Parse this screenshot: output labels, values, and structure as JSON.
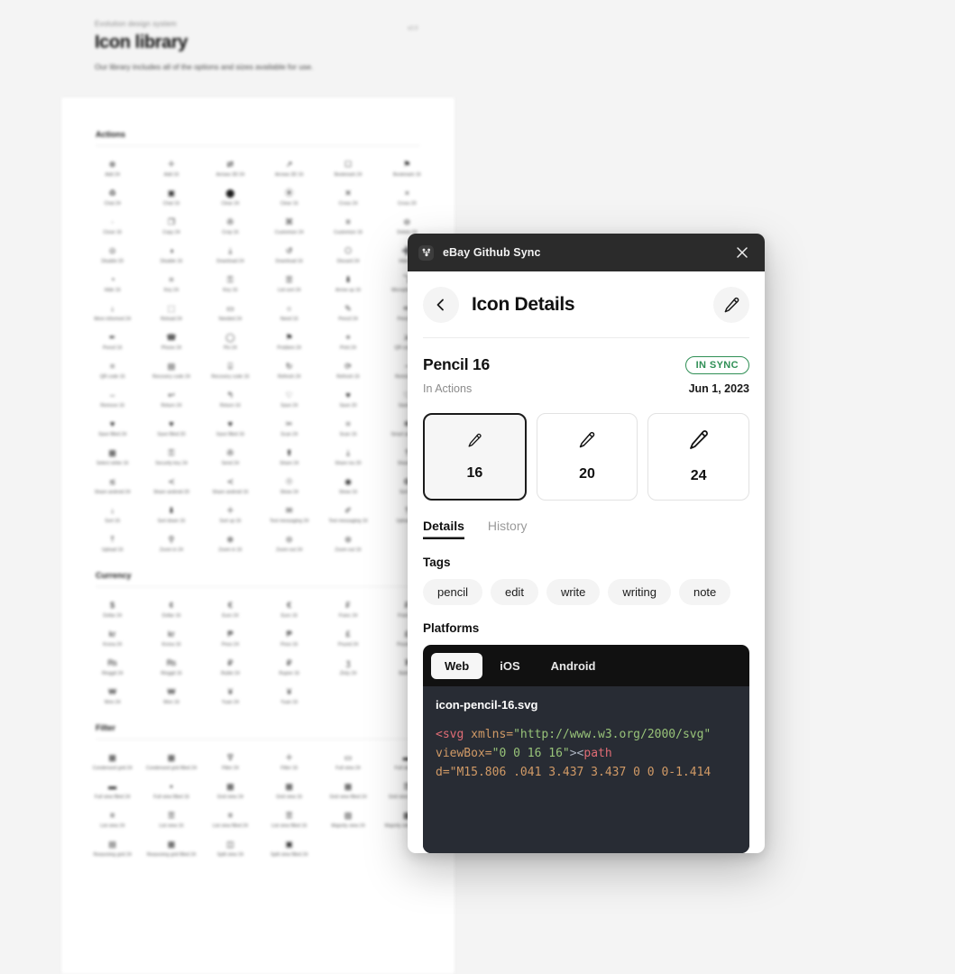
{
  "background": {
    "eyebrow": "Evolution design system",
    "title": "Icon library",
    "subtitle": "Our library includes all of the options and sizes available for use.",
    "corner_note": "v2.0",
    "sections": [
      {
        "name": "Actions",
        "icons": [
          {
            "glyph": "⊕",
            "label": "Add 24"
          },
          {
            "glyph": "＋",
            "label": "Add 16"
          },
          {
            "glyph": "⇄",
            "label": "Arrows 3D 24"
          },
          {
            "glyph": "↗",
            "label": "Arrows 3D 16"
          },
          {
            "glyph": "☐",
            "label": "Bookmark 24"
          },
          {
            "glyph": "⚑",
            "label": "Bookmark 16"
          },
          {
            "glyph": "♻",
            "label": "Chat 24"
          },
          {
            "glyph": "▣",
            "label": "Chat 16"
          },
          {
            "glyph": "⬤",
            "label": "Clear 24"
          },
          {
            "glyph": "⦿",
            "label": "Clear 16"
          },
          {
            "glyph": "✕",
            "label": "Cross 24"
          },
          {
            "glyph": "×",
            "label": "Cross 20"
          },
          {
            "glyph": "·",
            "label": "Close 16"
          },
          {
            "glyph": "❐",
            "label": "Copy 24"
          },
          {
            "glyph": "✇",
            "label": "Crop 16"
          },
          {
            "glyph": "⌘",
            "label": "Customize 24"
          },
          {
            "glyph": "≡",
            "label": "Customize 16"
          },
          {
            "glyph": "⊖",
            "label": "Delete 24"
          },
          {
            "glyph": "⊙",
            "label": "Disable 20"
          },
          {
            "glyph": "◑",
            "label": "Disable 16"
          },
          {
            "glyph": "⤓",
            "label": "Download 24"
          },
          {
            "glyph": "↺",
            "label": "Download 16"
          },
          {
            "glyph": "⎔",
            "label": "Discard 24"
          },
          {
            "glyph": "➕",
            "label": "Hide 24"
          },
          {
            "glyph": "◔",
            "label": "Hide 16"
          },
          {
            "glyph": "⌗",
            "label": "Key 24"
          },
          {
            "glyph": "⚿",
            "label": "Key 16"
          },
          {
            "glyph": "☰",
            "label": "List sort 24"
          },
          {
            "glyph": "⬇",
            "label": "Arrow up 16"
          },
          {
            "glyph": "⤵",
            "label": "Microphone 24"
          },
          {
            "glyph": "↓",
            "label": "More informed 24"
          },
          {
            "glyph": "⬚",
            "label": "Reload 24"
          },
          {
            "glyph": "▭",
            "label": "Needed 24"
          },
          {
            "glyph": "○",
            "label": "Need 16"
          },
          {
            "glyph": "✎",
            "label": "Pencil 24"
          },
          {
            "glyph": "✏",
            "label": "Pencil 20"
          },
          {
            "glyph": "✒",
            "label": "Pencil 16"
          },
          {
            "glyph": "☎",
            "label": "Phone 24"
          },
          {
            "glyph": "◯",
            "label": "Pin 24"
          },
          {
            "glyph": "⚑",
            "label": "Problem 24"
          },
          {
            "glyph": "⌖",
            "label": "Print 24"
          },
          {
            "glyph": "⚔",
            "label": "QR code 24"
          },
          {
            "glyph": "⌗",
            "label": "QR code 16"
          },
          {
            "glyph": "▤",
            "label": "Recovery code 24"
          },
          {
            "glyph": "⌸",
            "label": "Recovery code 16"
          },
          {
            "glyph": "↻",
            "label": "Refresh 24"
          },
          {
            "glyph": "⟳",
            "label": "Refresh 16"
          },
          {
            "glyph": "−",
            "label": "Remove 24"
          },
          {
            "glyph": "–",
            "label": "Remove 16"
          },
          {
            "glyph": "↩",
            "label": "Return 24"
          },
          {
            "glyph": "↰",
            "label": "Return 16"
          },
          {
            "glyph": "♡",
            "label": "Save 24"
          },
          {
            "glyph": "♥",
            "label": "Save 20"
          },
          {
            "glyph": "♡",
            "label": "Save 16"
          },
          {
            "glyph": "♥",
            "label": "Save filled 24"
          },
          {
            "glyph": "♥",
            "label": "Save filled 20"
          },
          {
            "glyph": "♥",
            "label": "Save filled 16"
          },
          {
            "glyph": "✂",
            "label": "Scan 24"
          },
          {
            "glyph": "⌗",
            "label": "Scan 16"
          },
          {
            "glyph": "❄",
            "label": "Smart assist 24"
          },
          {
            "glyph": "▦",
            "label": "Select strike 16"
          },
          {
            "glyph": "⚿",
            "label": "Security key 24"
          },
          {
            "glyph": "✇",
            "label": "Send 24"
          },
          {
            "glyph": "⬆",
            "label": "Share 24"
          },
          {
            "glyph": "⤓",
            "label": "Share ios 20"
          },
          {
            "glyph": "⤒",
            "label": "Share 16"
          },
          {
            "glyph": "≲",
            "label": "Share android 24"
          },
          {
            "glyph": "≺",
            "label": "Share android 20"
          },
          {
            "glyph": "≺",
            "label": "Share android 16"
          },
          {
            "glyph": "☉",
            "label": "Show 24"
          },
          {
            "glyph": "◉",
            "label": "Show 16"
          },
          {
            "glyph": "⚙",
            "label": "Sort 24"
          },
          {
            "glyph": "↓",
            "label": "Sort 16"
          },
          {
            "glyph": "⬇",
            "label": "Sort down 16"
          },
          {
            "glyph": "＋",
            "label": "Sort up 16"
          },
          {
            "glyph": "✉",
            "label": "Text messaging 24"
          },
          {
            "glyph": "✐",
            "label": "Text messaging 16"
          },
          {
            "glyph": "⤒",
            "label": "Upload 24"
          },
          {
            "glyph": "⤒",
            "label": "Upload 16"
          },
          {
            "glyph": "⚲",
            "label": "Zoom in 24"
          },
          {
            "glyph": "⊕",
            "label": "Zoom in 16"
          },
          {
            "glyph": "⊝",
            "label": "Zoom out 24"
          },
          {
            "glyph": "⊜",
            "label": "Zoom out 16"
          }
        ]
      },
      {
        "name": "Currency",
        "icons": [
          {
            "glyph": "$",
            "label": "Dollar 24"
          },
          {
            "glyph": "¢",
            "label": "Dollar 16"
          },
          {
            "glyph": "€",
            "label": "Euro 24"
          },
          {
            "glyph": "€",
            "label": "Euro 16"
          },
          {
            "glyph": "₣",
            "label": "Franc 24"
          },
          {
            "glyph": "₣",
            "label": "Franc 16"
          },
          {
            "glyph": "kr",
            "label": "Krona 24"
          },
          {
            "glyph": "kr",
            "label": "Krona 16"
          },
          {
            "glyph": "₱",
            "label": "Peso 24"
          },
          {
            "glyph": "₱",
            "label": "Peso 16"
          },
          {
            "glyph": "£",
            "label": "Pound 24"
          },
          {
            "glyph": "£",
            "label": "Pound 16"
          },
          {
            "glyph": "₨",
            "label": "Ringgit 24"
          },
          {
            "glyph": "₨",
            "label": "Ringgit 16"
          },
          {
            "glyph": "₽",
            "label": "Ruble 24"
          },
          {
            "glyph": "₽",
            "label": "Rupee 16"
          },
          {
            "glyph": "ʒ",
            "label": "Zloty 24"
          },
          {
            "glyph": "₮",
            "label": "Baht 16"
          },
          {
            "glyph": "₩",
            "label": "Won 24"
          },
          {
            "glyph": "₩",
            "label": "Won 16"
          },
          {
            "glyph": "¥",
            "label": "Yuan 24"
          },
          {
            "glyph": "¥",
            "label": "Yuan 16"
          }
        ]
      },
      {
        "name": "Filter",
        "icons": [
          {
            "glyph": "▦",
            "label": "Condensed grid 24"
          },
          {
            "glyph": "▦",
            "label": "Condensed grid filled 24"
          },
          {
            "glyph": "∇",
            "label": "Filter 24"
          },
          {
            "glyph": "＋",
            "label": "Filter 16"
          },
          {
            "glyph": "▭",
            "label": "Full view 24"
          },
          {
            "glyph": "▬",
            "label": "Full view 16"
          },
          {
            "glyph": "▬",
            "label": "Full view filled 24"
          },
          {
            "glyph": "▪",
            "label": "Full view filled 16"
          },
          {
            "glyph": "▦",
            "label": "Grid view 24"
          },
          {
            "glyph": "▦",
            "label": "Grid view 16"
          },
          {
            "glyph": "▦",
            "label": "Grid view filled 24"
          },
          {
            "glyph": "☰",
            "label": "Grid view filled 16"
          },
          {
            "glyph": "≡",
            "label": "List view 24"
          },
          {
            "glyph": "☰",
            "label": "List view 16"
          },
          {
            "glyph": "≡",
            "label": "List view filled 24"
          },
          {
            "glyph": "☰",
            "label": "List view filled 16"
          },
          {
            "glyph": "▨",
            "label": "Majority view 24"
          },
          {
            "glyph": "▩",
            "label": "Majority view filled 24"
          },
          {
            "glyph": "▤",
            "label": "Reasoning grid 24"
          },
          {
            "glyph": "▦",
            "label": "Reasoning grid filled 24"
          },
          {
            "glyph": "◫",
            "label": "Split view 24"
          },
          {
            "glyph": "▣",
            "label": "Split view filled 24"
          }
        ]
      }
    ]
  },
  "modal": {
    "titlebar": {
      "app_name": "eBay Github Sync",
      "close_label": "×"
    },
    "header": {
      "title": "Icon Details",
      "back_label": "back",
      "edit_label": "edit"
    },
    "icon": {
      "name": "Pencil 16",
      "status": "IN SYNC",
      "status_color": "#2f8f55",
      "group": "In Actions",
      "date": "Jun 1, 2023"
    },
    "sizes": [
      {
        "value": "16",
        "selected": true
      },
      {
        "value": "20",
        "selected": false
      },
      {
        "value": "24",
        "selected": false
      }
    ],
    "tabs": [
      {
        "label": "Details",
        "active": true
      },
      {
        "label": "History",
        "active": false
      }
    ],
    "tags_label": "Tags",
    "tags": [
      "pencil",
      "edit",
      "write",
      "writing",
      "note"
    ],
    "platforms_label": "Platforms",
    "platforms": [
      {
        "label": "Web",
        "active": true
      },
      {
        "label": "iOS",
        "active": false
      },
      {
        "label": "Android",
        "active": false
      }
    ],
    "code": {
      "filename": "icon-pencil-16.svg",
      "line1_tag": "<svg",
      "line1_attr": " xmlns=",
      "line1_str": "\"http://www.w3.org/2000/svg\"",
      "line2_attr": "viewBox=",
      "line2_str": "\"0 0 16 16\"",
      "line2_punc": "><",
      "line2_tag": "path",
      "line3": "d=\"M15.806 .041 3.437 3.437 0 0 0-1.414"
    }
  }
}
